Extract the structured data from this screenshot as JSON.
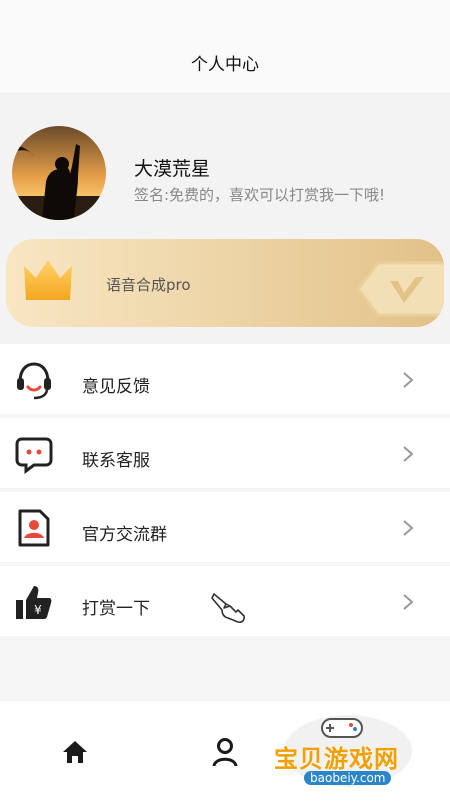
{
  "header": {
    "title": "个人中心"
  },
  "profile": {
    "username": "大漠荒星",
    "signature": "签名:免费的，喜欢可以打赏我一下哦!",
    "avatar_icon": "avatar-photo"
  },
  "vip": {
    "label": "语音合成pro",
    "icon": "crown-icon",
    "badge_icon": "v-badge-icon"
  },
  "menu": {
    "items": [
      {
        "label": "意见反馈",
        "icon": "headset-icon"
      },
      {
        "label": "联系客服",
        "icon": "chat-bubble-icon"
      },
      {
        "label": "官方交流群",
        "icon": "contact-card-icon"
      },
      {
        "label": "打赏一下",
        "icon": "thumbs-up-yen-icon"
      }
    ]
  },
  "tabbar": {
    "items": [
      {
        "icon": "home-icon"
      },
      {
        "icon": "user-icon"
      }
    ]
  },
  "watermark": {
    "text": "宝贝游戏网",
    "domain": "baobeiy.com"
  },
  "colors": {
    "accent_red": "#e64a3b",
    "gold": "#e8c98f",
    "crown": "#f5b22e"
  }
}
